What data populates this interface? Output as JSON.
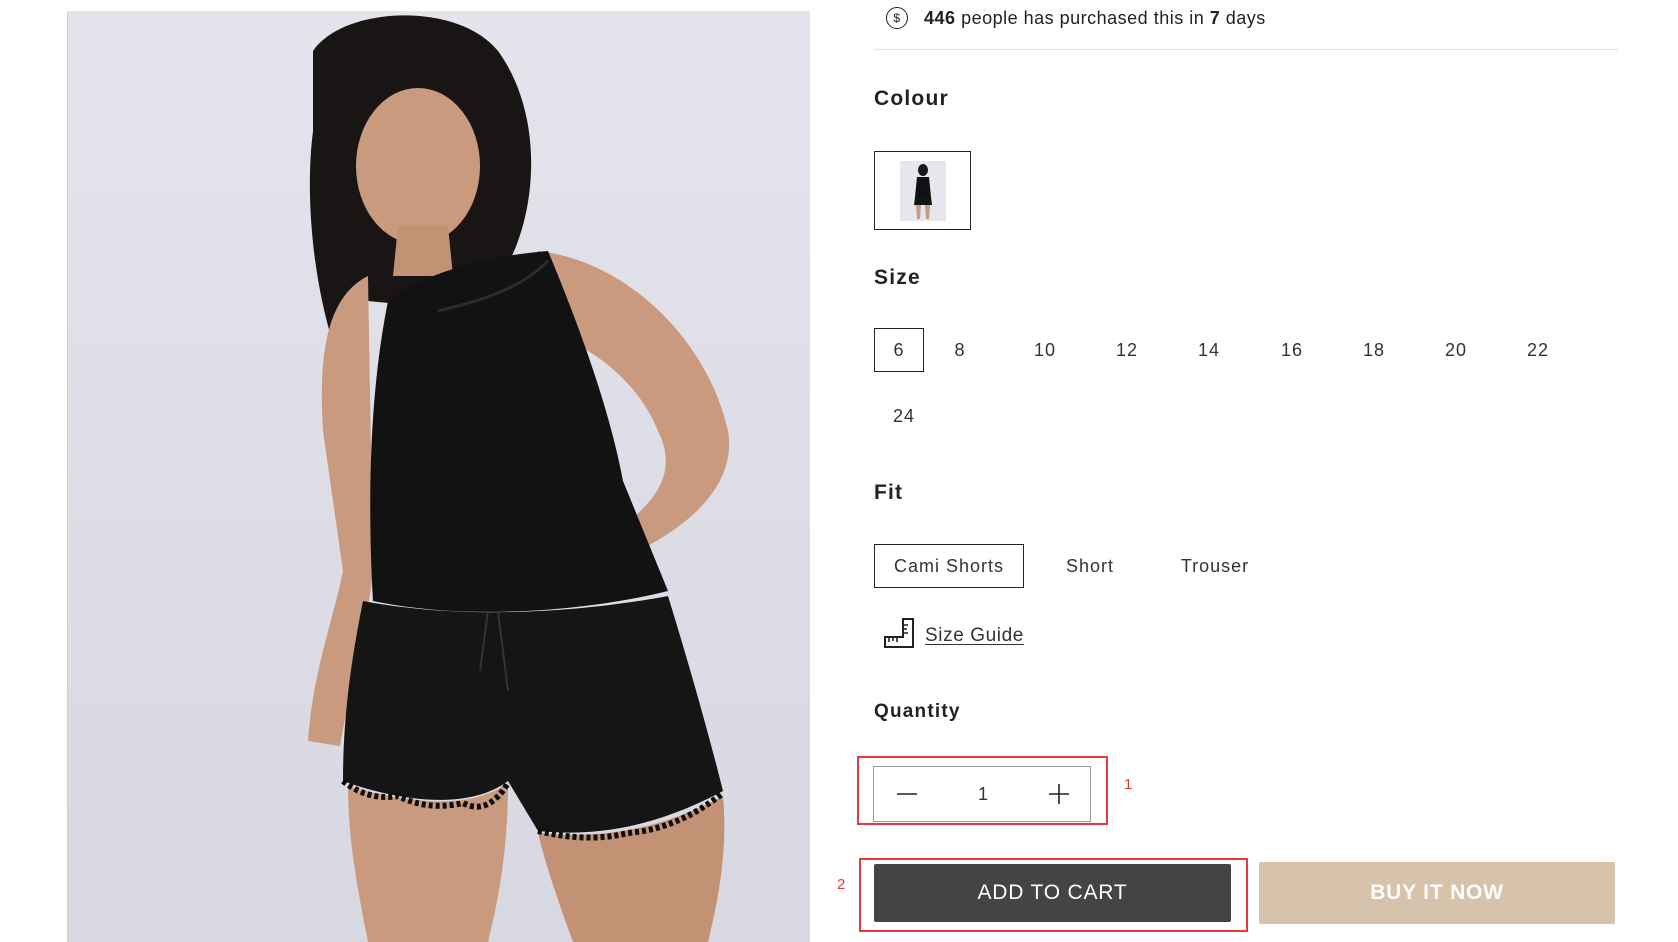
{
  "purchase_notice": {
    "icon": "dollar-coin-icon",
    "count": "446",
    "text_middle": "people has purchased this in",
    "days": "7",
    "text_end": "days"
  },
  "colour": {
    "label": "Colour",
    "selected_swatch": "black-satin-cami-set"
  },
  "size": {
    "label": "Size",
    "options": [
      "6",
      "8",
      "10",
      "12",
      "14",
      "16",
      "18",
      "20",
      "22",
      "24"
    ],
    "selected": "6"
  },
  "fit": {
    "label": "Fit",
    "options": [
      "Cami Shorts",
      "Short",
      "Trouser"
    ],
    "selected": "Cami Shorts"
  },
  "size_guide": {
    "icon": "ruler-icon",
    "label": "Size Guide"
  },
  "quantity": {
    "label": "Quantity",
    "value": "1",
    "decrease_icon": "minus-icon",
    "increase_icon": "plus-icon"
  },
  "markers": {
    "quantity": "1",
    "add_to_cart": "2"
  },
  "actions": {
    "add_to_cart": "ADD TO CART",
    "buy_now": "BUY IT NOW"
  },
  "colors": {
    "add_to_cart_bg": "#444444",
    "buy_now_bg": "#d7c3ab",
    "highlight": "#e23b3b"
  }
}
